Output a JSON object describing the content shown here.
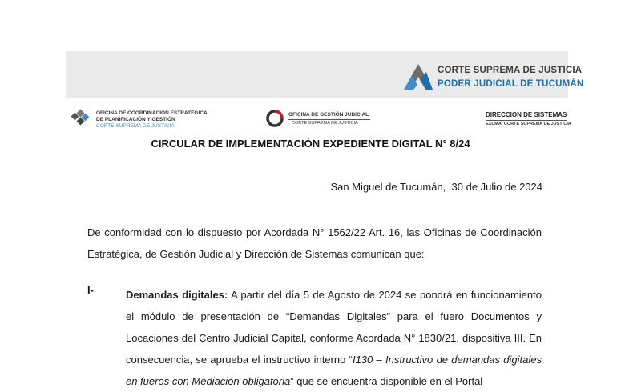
{
  "header": {
    "court_line1": "CORTE SUPREMA DE JUSTICIA",
    "court_line2": "PODER JUDICIAL DE TUCUMÁN",
    "ocep_line1": "OFICINA DE COORDINACIÓN ESTRATÉGICA",
    "ocep_line2": "DE PLANIFICACIÓN Y GESTIÓN",
    "ocep_line3": "CORTE SUPREMA DE JUSTICIA",
    "ogj_line1": "OFICINA DE GESTIÓN JUDICIAL",
    "ogj_line2": "CORTE SUPREMA DE JUSTICIA",
    "ds_line1": "DIRECCION DE SISTEMAS",
    "ds_line2": "EXCMA. CORTE SUPREMA DE JUSTICIA",
    "colors": {
      "court_blue": "#1f6fae",
      "ogj_red": "#c0202a",
      "banner_gray": "#eaeaea"
    }
  },
  "document": {
    "title": "CIRCULAR DE IMPLEMENTACIÓN EXPEDIENTE DIGITAL N° 8/24",
    "date_line": "San Miguel de Tucumán,  30 de Julio de 2024",
    "intro_paragraph": "De conformidad con lo dispuesto por Acordada N° 1562/22 Art. 16, las Oficinas de Coordinación Estratégica, de Gestión Judicial y Dirección de Sistemas comunican que:",
    "item1": {
      "number": "I-",
      "heading": "Demandas digitales:",
      "text_part1": " A partir del día 5 de Agosto de 2024 se pondrá en funcionamiento el módulo de presentación de “Demandas Digitales” para el fuero Documentos y Locaciones del Centro Judicial Capital, conforme Acordada N° 1830/21, dispositiva III. En consecuencia, se aprueba el instructivo interno “",
      "italic_part": "I130 – Instructivo de demandas digitales en fueros con Mediación obligatoria",
      "text_part2": "” que se encuentra disponible en el Portal"
    }
  }
}
